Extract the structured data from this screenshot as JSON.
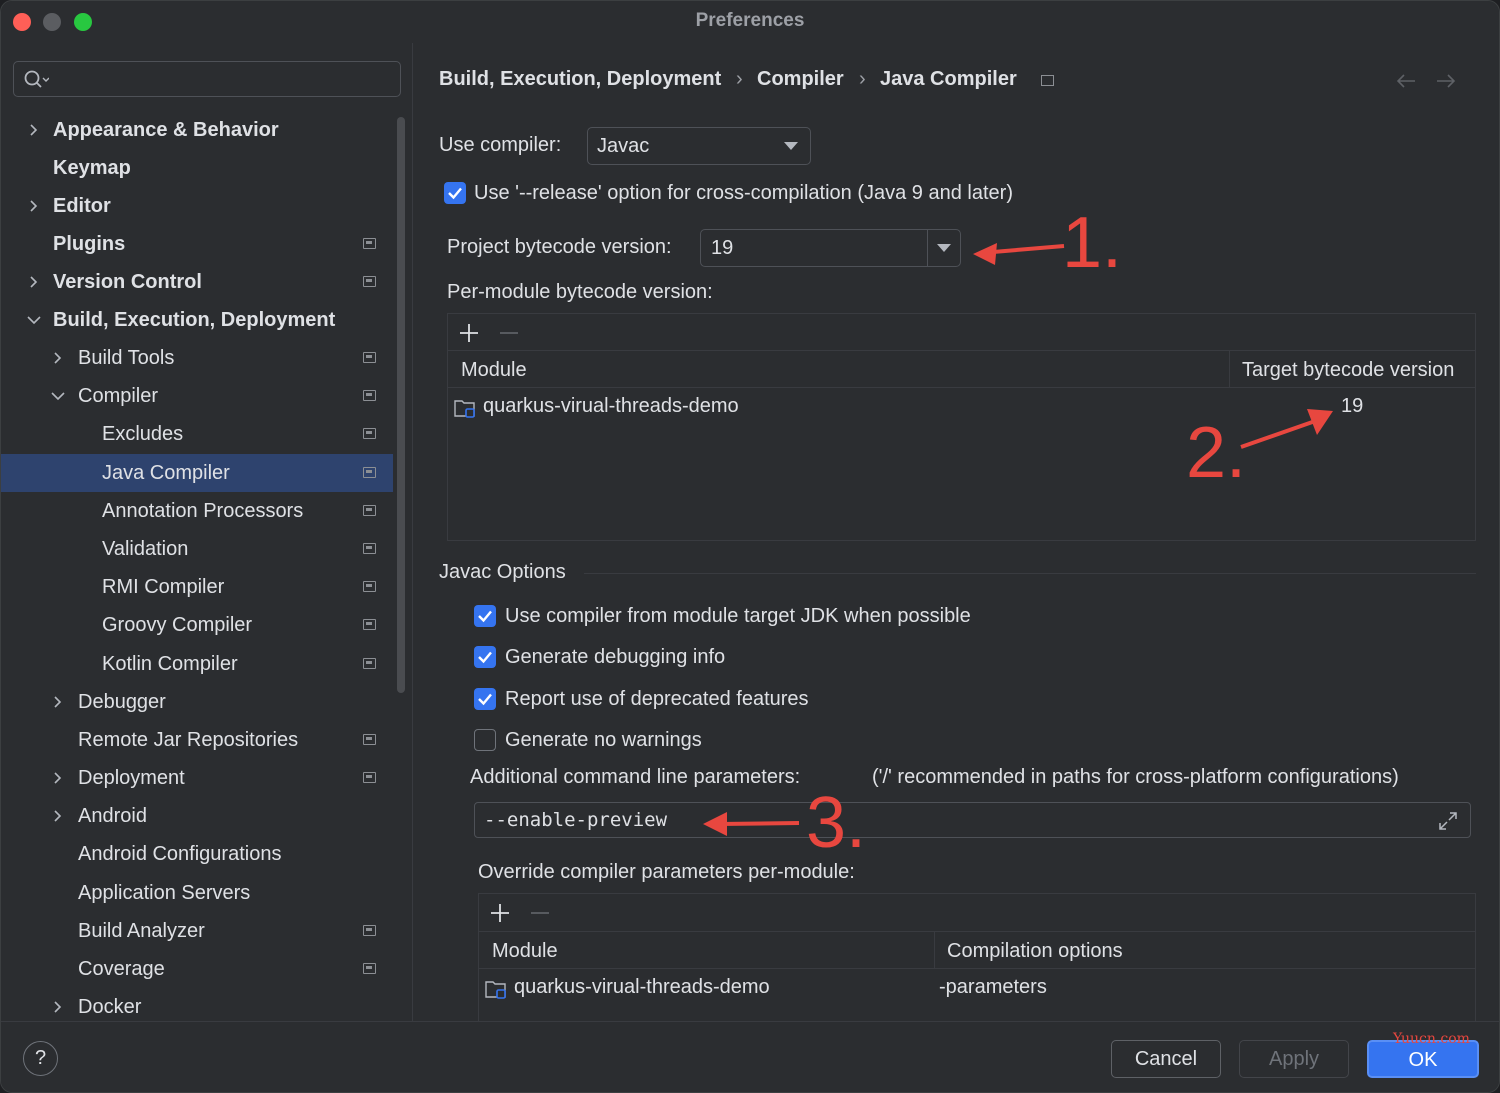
{
  "window": {
    "title": "Preferences"
  },
  "search": {
    "placeholder": ""
  },
  "sidebar": {
    "items": [
      {
        "label": "Appearance & Behavior"
      },
      {
        "label": "Keymap"
      },
      {
        "label": "Editor"
      },
      {
        "label": "Plugins"
      },
      {
        "label": "Version Control"
      },
      {
        "label": "Build, Execution, Deployment"
      },
      {
        "label": "Build Tools"
      },
      {
        "label": "Compiler"
      },
      {
        "label": "Excludes"
      },
      {
        "label": "Java Compiler"
      },
      {
        "label": "Annotation Processors"
      },
      {
        "label": "Validation"
      },
      {
        "label": "RMI Compiler"
      },
      {
        "label": "Groovy Compiler"
      },
      {
        "label": "Kotlin Compiler"
      },
      {
        "label": "Debugger"
      },
      {
        "label": "Remote Jar Repositories"
      },
      {
        "label": "Deployment"
      },
      {
        "label": "Android"
      },
      {
        "label": "Android Configurations"
      },
      {
        "label": "Application Servers"
      },
      {
        "label": "Build Analyzer"
      },
      {
        "label": "Coverage"
      },
      {
        "label": "Docker"
      }
    ]
  },
  "breadcrumb": {
    "part1": "Build, Execution, Deployment",
    "part2": "Compiler",
    "part3": "Java Compiler",
    "sep": "›"
  },
  "compiler": {
    "use_label": "Use compiler:",
    "use_value": "Javac",
    "release_label": "Use '--release' option for cross-compilation (Java 9 and later)",
    "bytecode_label": "Project bytecode version:",
    "bytecode_value": "19",
    "per_module_label": "Per-module bytecode version:",
    "table1": {
      "col_module": "Module",
      "col_target": "Target bytecode version",
      "row_module": "quarkus-virual-threads-demo",
      "row_target": "19"
    }
  },
  "javac": {
    "section": "Javac Options",
    "opt1": "Use compiler from module target JDK when possible",
    "opt2": "Generate debugging info",
    "opt3": "Report use of deprecated features",
    "opt4": "Generate no warnings",
    "params_label": "Additional command line parameters:",
    "params_hint": "('/' recommended in paths for cross-platform configurations)",
    "params_value": "--enable-preview",
    "override_label": "Override compiler parameters per-module:",
    "table2": {
      "col_module": "Module",
      "col_options": "Compilation options",
      "row_module": "quarkus-virual-threads-demo",
      "row_options": "-parameters"
    }
  },
  "annotations": {
    "a1": "1.",
    "a2": "2.",
    "a3": "3."
  },
  "footer": {
    "help": "?",
    "cancel": "Cancel",
    "apply": "Apply",
    "ok": "OK",
    "watermark": "Yuucn.com"
  },
  "colors": {
    "accent": "#3574f0",
    "selection": "#2e436e",
    "annotation": "#e8473f"
  }
}
